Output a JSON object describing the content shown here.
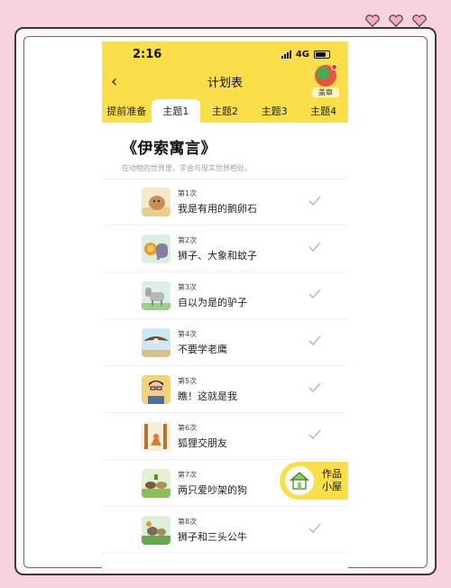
{
  "status": {
    "time": "2:16",
    "network": "4G"
  },
  "nav": {
    "back_icon": "‹",
    "title": "计划表",
    "stamp_label": "盖章"
  },
  "tabs": [
    {
      "label": "提前准备"
    },
    {
      "label": "主题1",
      "active": true
    },
    {
      "label": "主题2"
    },
    {
      "label": "主题3"
    },
    {
      "label": "主题4"
    }
  ],
  "book": {
    "title": "《伊索寓言》",
    "subtitle": "在动物的世界里，学会与现实世界相处。"
  },
  "items": [
    {
      "num": "第1次",
      "title": "我是有用的鹅卵石",
      "thumb": "rock-icon"
    },
    {
      "num": "第2次",
      "title": "狮子、大象和蚊子",
      "thumb": "lion-elephant-icon"
    },
    {
      "num": "第3次",
      "title": "自以为是的驴子",
      "thumb": "donkey-icon"
    },
    {
      "num": "第4次",
      "title": "不要学老鹰",
      "thumb": "eagle-icon"
    },
    {
      "num": "第5次",
      "title": "瞧！这就是我",
      "thumb": "boy-icon"
    },
    {
      "num": "第6次",
      "title": "狐狸交朋友",
      "thumb": "fox-icon"
    },
    {
      "num": "第7次",
      "title": "两只爱吵架的狗",
      "thumb": "dogs-icon"
    },
    {
      "num": "第8次",
      "title": "狮子和三头公牛",
      "thumb": "bulls-icon"
    }
  ],
  "fab": {
    "line1": "作品",
    "line2": "小屋"
  },
  "colors": {
    "accent": "#fadf4a",
    "frame_bg": "#f7d3e0",
    "check": "#b9bec4"
  }
}
